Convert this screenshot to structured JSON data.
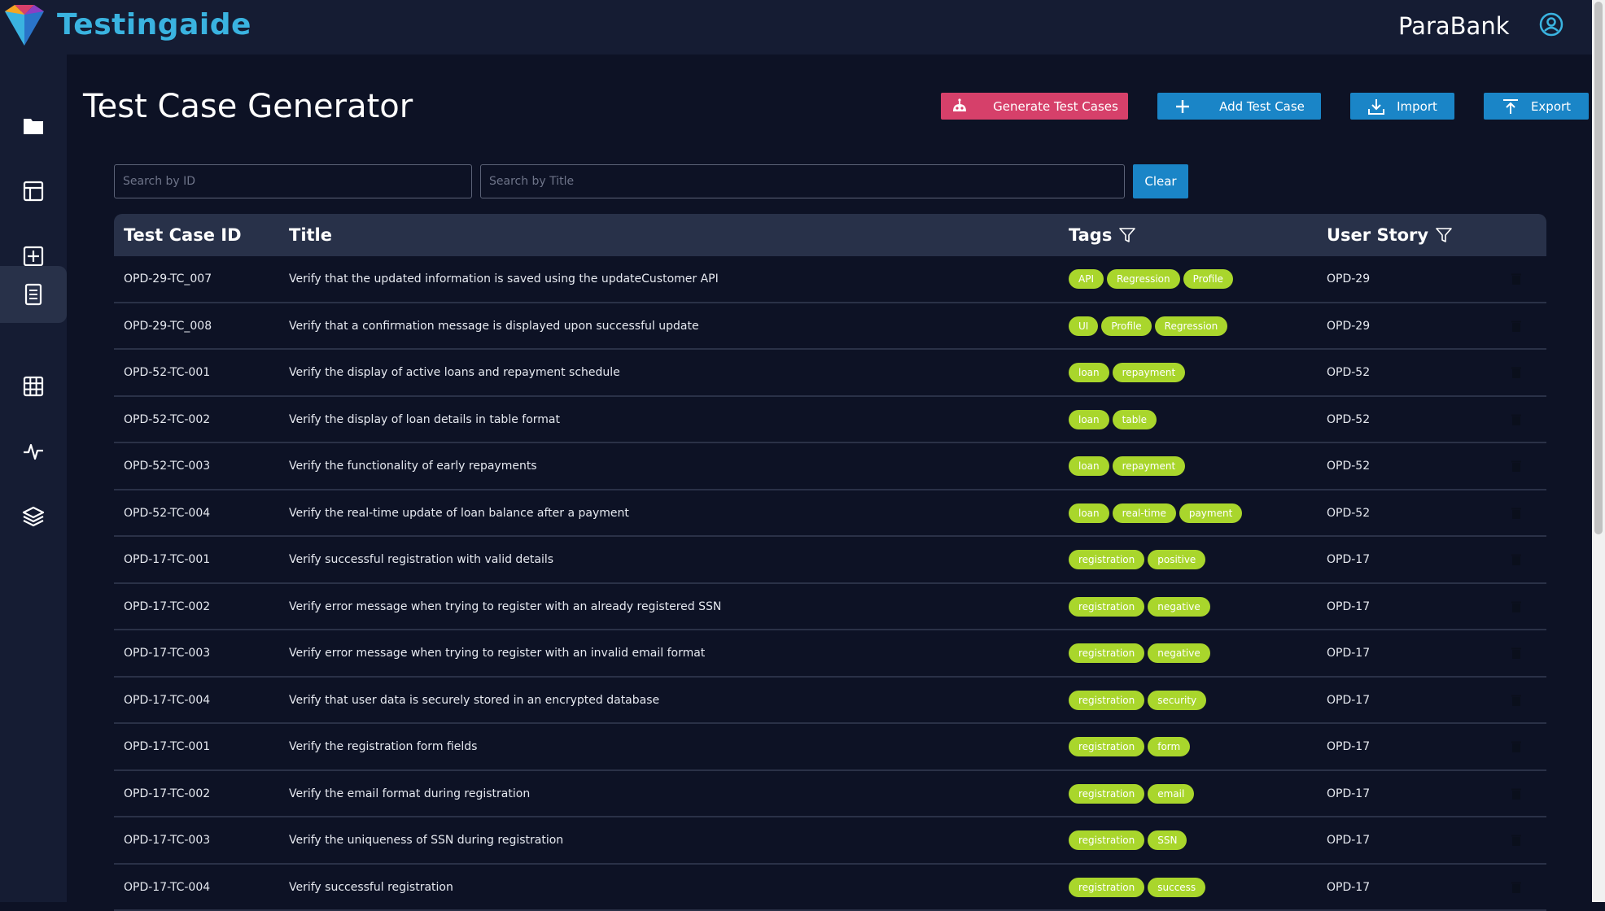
{
  "brand": {
    "name": "Testingaide"
  },
  "header": {
    "project": "ParaBank"
  },
  "page": {
    "title": "Test Case Generator"
  },
  "actions": {
    "generate": "Generate Test Cases",
    "add": "Add Test Case",
    "import": "Import",
    "export": "Export"
  },
  "search": {
    "id_placeholder": "Search by ID",
    "title_placeholder": "Search by Title",
    "clear": "Clear"
  },
  "table": {
    "headers": {
      "id": "Test Case ID",
      "title": "Title",
      "tags": "Tags",
      "story": "User Story"
    },
    "rows": [
      {
        "id": "OPD-29-TC_007",
        "title": "Verify that the updated information is saved using the updateCustomer API",
        "tags": [
          "API",
          "Regression",
          "Profile"
        ],
        "story": "OPD-29"
      },
      {
        "id": "OPD-29-TC_008",
        "title": "Verify that a confirmation message is displayed upon successful update",
        "tags": [
          "UI",
          "Profile",
          "Regression"
        ],
        "story": "OPD-29"
      },
      {
        "id": "OPD-52-TC-001",
        "title": "Verify the display of active loans and repayment schedule",
        "tags": [
          "loan",
          "repayment"
        ],
        "story": "OPD-52"
      },
      {
        "id": "OPD-52-TC-002",
        "title": "Verify the display of loan details in table format",
        "tags": [
          "loan",
          "table"
        ],
        "story": "OPD-52"
      },
      {
        "id": "OPD-52-TC-003",
        "title": "Verify the functionality of early repayments",
        "tags": [
          "loan",
          "repayment"
        ],
        "story": "OPD-52"
      },
      {
        "id": "OPD-52-TC-004",
        "title": "Verify the real-time update of loan balance after a payment",
        "tags": [
          "loan",
          "real-time",
          "payment"
        ],
        "story": "OPD-52"
      },
      {
        "id": "OPD-17-TC-001",
        "title": "Verify successful registration with valid details",
        "tags": [
          "registration",
          "positive"
        ],
        "story": "OPD-17"
      },
      {
        "id": "OPD-17-TC-002",
        "title": "Verify error message when trying to register with an already registered SSN",
        "tags": [
          "registration",
          "negative"
        ],
        "story": "OPD-17"
      },
      {
        "id": "OPD-17-TC-003",
        "title": "Verify error message when trying to register with an invalid email format",
        "tags": [
          "registration",
          "negative"
        ],
        "story": "OPD-17"
      },
      {
        "id": "OPD-17-TC-004",
        "title": "Verify that user data is securely stored in an encrypted database",
        "tags": [
          "registration",
          "security"
        ],
        "story": "OPD-17"
      },
      {
        "id": "OPD-17-TC-001",
        "title": "Verify the registration form fields",
        "tags": [
          "registration",
          "form"
        ],
        "story": "OPD-17"
      },
      {
        "id": "OPD-17-TC-002",
        "title": "Verify the email format during registration",
        "tags": [
          "registration",
          "email"
        ],
        "story": "OPD-17"
      },
      {
        "id": "OPD-17-TC-003",
        "title": "Verify the uniqueness of SSN during registration",
        "tags": [
          "registration",
          "SSN"
        ],
        "story": "OPD-17"
      },
      {
        "id": "OPD-17-TC-004",
        "title": "Verify successful registration",
        "tags": [
          "registration",
          "success"
        ],
        "story": "OPD-17"
      }
    ]
  },
  "colors": {
    "background": "#0d1225",
    "panel": "#151c33",
    "header_row": "#283149",
    "accent_blue": "#1a85c7",
    "accent_pink": "#d6406a",
    "tag_green": "#a9d62c",
    "brand_blue": "#3ab3e0"
  },
  "icons": {
    "sidebar": [
      "folder-icon",
      "layout-icon",
      "plus-square-icon",
      "document-icon",
      "grid-icon",
      "activity-icon",
      "layers-icon"
    ],
    "header": [
      "user-circle-icon"
    ],
    "filter": "filter-icon",
    "row_action": "trash-icon"
  }
}
